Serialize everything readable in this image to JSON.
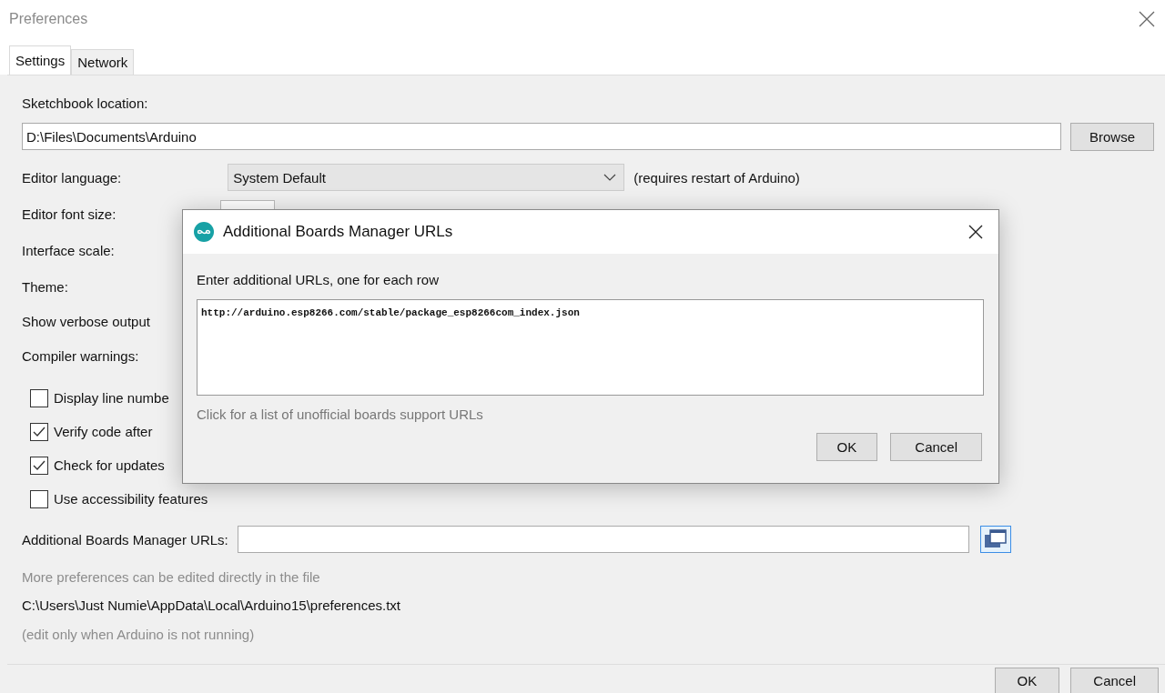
{
  "window": {
    "title": "Preferences"
  },
  "tabs": [
    {
      "label": "Settings",
      "selected": true
    },
    {
      "label": "Network",
      "selected": false
    }
  ],
  "settings": {
    "sketchbook_label": "Sketchbook location:",
    "sketchbook_path": "D:\\Files\\Documents\\Arduino",
    "browse": "Browse",
    "language_label": "Editor language:",
    "language_value": "System Default",
    "language_note": "(requires restart of Arduino)",
    "labels": [
      "Editor font size:",
      "Interface scale:",
      "Theme:",
      "Show verbose output",
      "Compiler warnings:"
    ],
    "checkboxes": [
      {
        "label": "Display line numbe",
        "checked": false
      },
      {
        "label": "Verify code after",
        "checked": true
      },
      {
        "label": "Check for updates",
        "checked": true
      },
      {
        "label": "Use accessibility features",
        "checked": false
      }
    ],
    "urls_label": "Additional Boards Manager URLs:",
    "info_text": "More preferences can be edited directly in the file",
    "prefs_path": "C:\\Users\\Just Numie\\AppData\\Local\\Arduino15\\preferences.txt",
    "running_note": "(edit only when Arduino is not running)"
  },
  "buttons": [
    "OK",
    "Cancel"
  ],
  "dialog": {
    "title": "Additional Boards Manager URLs",
    "prompt": "Enter additional URLs, one for each row",
    "urls": "http://arduino.esp8266.com/stable/package_esp8266com_index.json",
    "link": "Click for a list of unofficial boards support URLs",
    "buttons": [
      "OK",
      "Cancel"
    ]
  }
}
